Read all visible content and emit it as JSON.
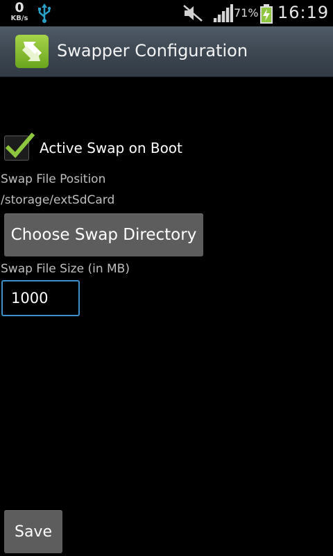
{
  "status_bar": {
    "net_speed": "0",
    "net_unit": "KB/s",
    "battery_percent": "71%",
    "time": "16:19",
    "icons": [
      "usb-icon",
      "mute-icon",
      "signal-icon",
      "battery-charging-icon"
    ]
  },
  "app": {
    "title": "Swapper Configuration",
    "icon": "swapper-app-icon"
  },
  "settings": {
    "active_on_boot_label": "Active Swap on Boot",
    "active_on_boot_checked": true,
    "swap_position_label": "Swap File Position",
    "swap_position_value": "/storage/extSdCard",
    "choose_dir_label": "Choose Swap Directory",
    "swap_size_label": "Swap File Size (in MB)",
    "swap_size_value": "1000",
    "save_label": "Save"
  },
  "colors": {
    "titlebar": "#3c4651",
    "check": "#8ec63f",
    "input_focus": "#3c92c9",
    "button": "#5d5d5d"
  }
}
